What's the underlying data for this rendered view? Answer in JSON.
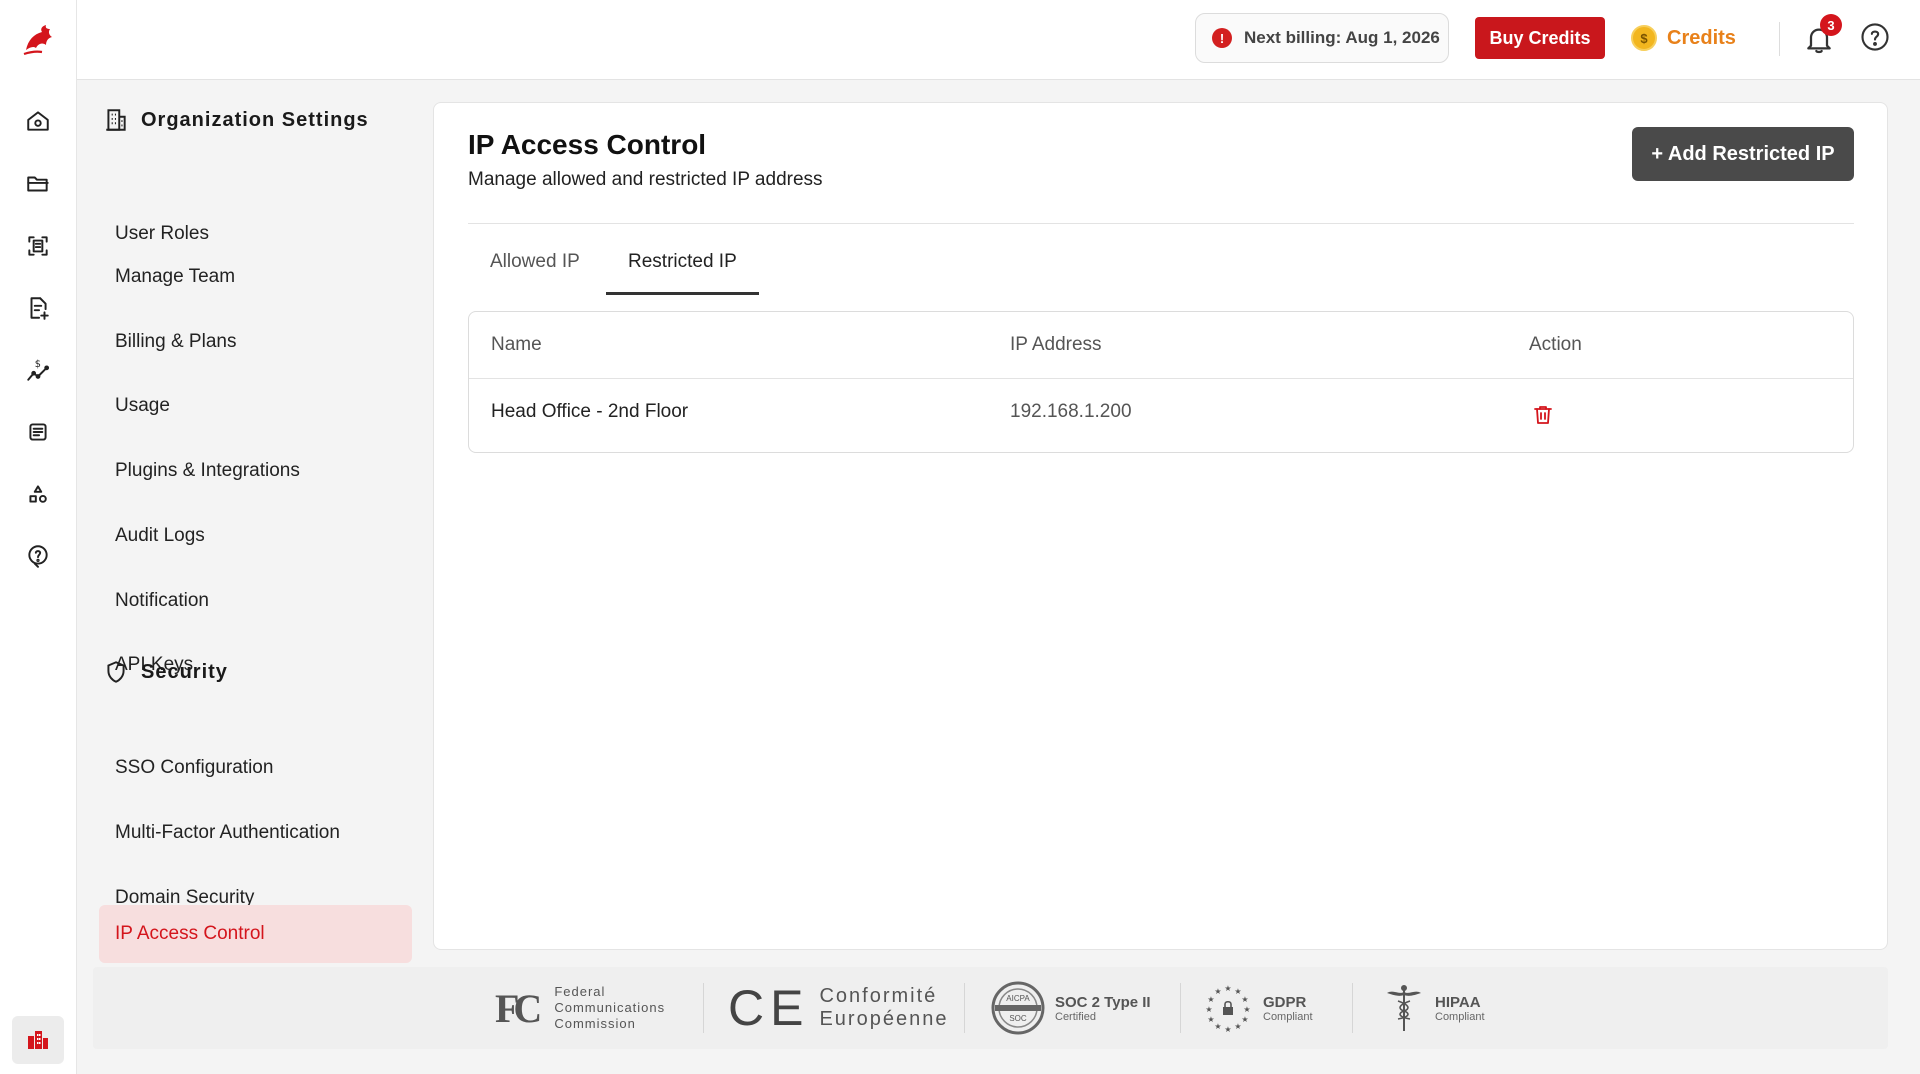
{
  "topbar": {
    "billing_text": "Next billing: Aug 1, 2026",
    "buy_credits_label": "Buy Credits",
    "credits_label": "Credits",
    "notification_count": "3"
  },
  "sidebar": {
    "org_heading": "Organization Settings",
    "clipped_item": "User Roles",
    "items": [
      {
        "label": "Manage Team"
      },
      {
        "label": "Billing & Plans"
      },
      {
        "label": "Usage"
      },
      {
        "label": "Plugins & Integrations"
      },
      {
        "label": "Audit Logs"
      },
      {
        "label": "Notification"
      },
      {
        "label": "API Keys"
      }
    ],
    "security_heading": "Security",
    "security_items": [
      {
        "label": "SSO Configuration"
      },
      {
        "label": "Multi-Factor Authentication"
      },
      {
        "label": "Domain Security"
      },
      {
        "label": "IP Access Control"
      }
    ]
  },
  "main": {
    "title": "IP Access Control",
    "subtitle": "Manage allowed and restricted IP address",
    "add_button": "+ Add Restricted IP",
    "tabs": [
      {
        "label": "Allowed IP",
        "active": false
      },
      {
        "label": "Restricted IP",
        "active": true
      }
    ],
    "table": {
      "headers": [
        "Name",
        "IP Address",
        "Action"
      ],
      "rows": [
        {
          "name": "Head Office - 2nd Floor",
          "ip": "192.168.1.200"
        }
      ]
    }
  },
  "footer": {
    "fcc": {
      "mark": "FC",
      "line1": "Federal",
      "line2": "Communications",
      "line3": "Commission"
    },
    "ce": {
      "mark": "CE",
      "line1": "Conformité",
      "line2": "Européenne"
    },
    "soc": {
      "seal_top": "AICPA",
      "seal_bottom": "SOC",
      "title": "SOC 2 Type II",
      "sub": "Certified"
    },
    "gdpr": {
      "title": "GDPR",
      "sub": "Compliant"
    },
    "hipaa": {
      "title": "HIPAA",
      "sub": "Compliant"
    }
  },
  "colors": {
    "accent": "#c9171c",
    "credits": "#e8811a",
    "active_nav_bg": "#f7dede",
    "dark_button": "#4a4a4a"
  }
}
